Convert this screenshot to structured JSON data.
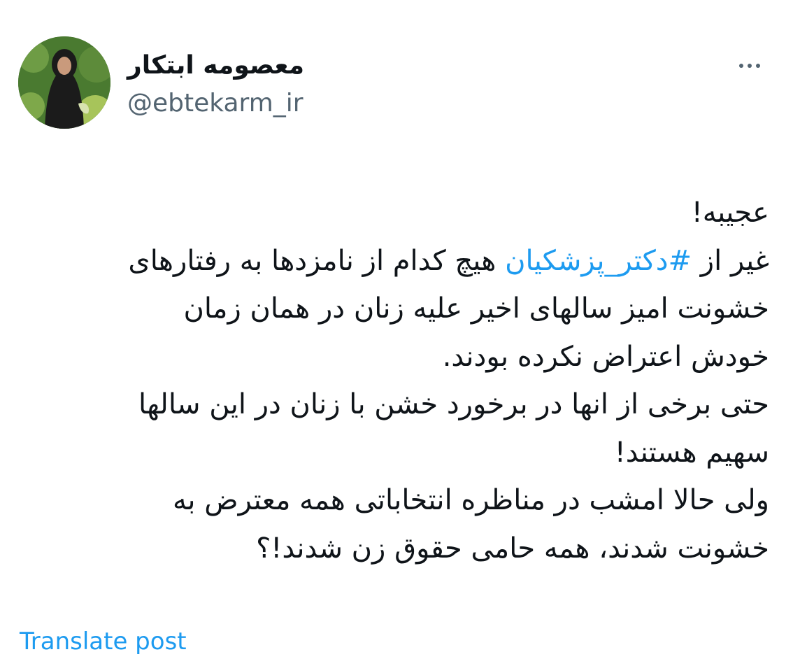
{
  "author": {
    "display_name": "معصومه ابتکار",
    "handle": "@ebtekarm_ir",
    "avatar_icon": "profile-photo"
  },
  "more_icon": "more-horizontal-icon",
  "tweet": {
    "line1": "عجیبه!",
    "line2_prefix": "غیر از ",
    "hashtag": "#دکتر_پزشکیان",
    "line2_suffix": " هیچ کدام از نامزدها به رفتارهای",
    "line3": "خشونت امیز سالهای اخیر علیه زنان در همان زمان",
    "line4": "خودش اعتراض نکرده بودند.",
    "line5": "حتی برخی از انها در برخورد خشن با زنان در این سالها",
    "line6": "سهیم هستند!",
    "line7": "ولی حالا امشب در مناظره انتخاباتی همه معترض به",
    "line8": "خشونت شدند، همه حامی حقوق زن شدند!؟"
  },
  "translate_label": "Translate post",
  "colors": {
    "link": "#1d9bf0",
    "secondary_text": "#536471",
    "primary_text": "#0f1419"
  }
}
